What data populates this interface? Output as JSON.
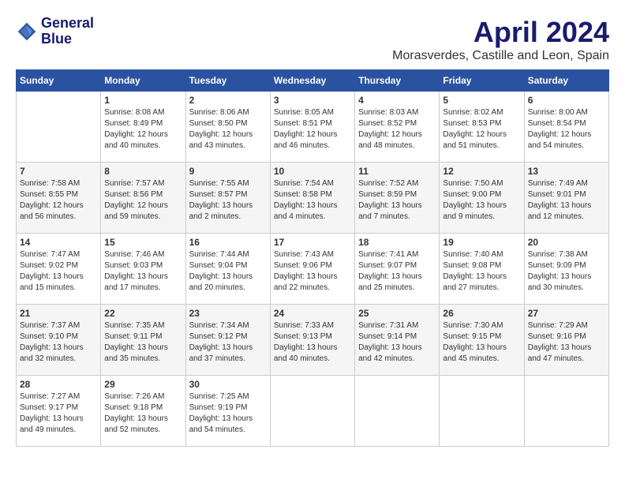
{
  "logo": {
    "line1": "General",
    "line2": "Blue"
  },
  "title": "April 2024",
  "subtitle": "Morasverdes, Castille and Leon, Spain",
  "weekdays": [
    "Sunday",
    "Monday",
    "Tuesday",
    "Wednesday",
    "Thursday",
    "Friday",
    "Saturday"
  ],
  "weeks": [
    [
      {
        "day": "",
        "sunrise": "",
        "sunset": "",
        "daylight": ""
      },
      {
        "day": "1",
        "sunrise": "Sunrise: 8:08 AM",
        "sunset": "Sunset: 8:49 PM",
        "daylight": "Daylight: 12 hours and 40 minutes."
      },
      {
        "day": "2",
        "sunrise": "Sunrise: 8:06 AM",
        "sunset": "Sunset: 8:50 PM",
        "daylight": "Daylight: 12 hours and 43 minutes."
      },
      {
        "day": "3",
        "sunrise": "Sunrise: 8:05 AM",
        "sunset": "Sunset: 8:51 PM",
        "daylight": "Daylight: 12 hours and 46 minutes."
      },
      {
        "day": "4",
        "sunrise": "Sunrise: 8:03 AM",
        "sunset": "Sunset: 8:52 PM",
        "daylight": "Daylight: 12 hours and 48 minutes."
      },
      {
        "day": "5",
        "sunrise": "Sunrise: 8:02 AM",
        "sunset": "Sunset: 8:53 PM",
        "daylight": "Daylight: 12 hours and 51 minutes."
      },
      {
        "day": "6",
        "sunrise": "Sunrise: 8:00 AM",
        "sunset": "Sunset: 8:54 PM",
        "daylight": "Daylight: 12 hours and 54 minutes."
      }
    ],
    [
      {
        "day": "7",
        "sunrise": "Sunrise: 7:58 AM",
        "sunset": "Sunset: 8:55 PM",
        "daylight": "Daylight: 12 hours and 56 minutes."
      },
      {
        "day": "8",
        "sunrise": "Sunrise: 7:57 AM",
        "sunset": "Sunset: 8:56 PM",
        "daylight": "Daylight: 12 hours and 59 minutes."
      },
      {
        "day": "9",
        "sunrise": "Sunrise: 7:55 AM",
        "sunset": "Sunset: 8:57 PM",
        "daylight": "Daylight: 13 hours and 2 minutes."
      },
      {
        "day": "10",
        "sunrise": "Sunrise: 7:54 AM",
        "sunset": "Sunset: 8:58 PM",
        "daylight": "Daylight: 13 hours and 4 minutes."
      },
      {
        "day": "11",
        "sunrise": "Sunrise: 7:52 AM",
        "sunset": "Sunset: 8:59 PM",
        "daylight": "Daylight: 13 hours and 7 minutes."
      },
      {
        "day": "12",
        "sunrise": "Sunrise: 7:50 AM",
        "sunset": "Sunset: 9:00 PM",
        "daylight": "Daylight: 13 hours and 9 minutes."
      },
      {
        "day": "13",
        "sunrise": "Sunrise: 7:49 AM",
        "sunset": "Sunset: 9:01 PM",
        "daylight": "Daylight: 13 hours and 12 minutes."
      }
    ],
    [
      {
        "day": "14",
        "sunrise": "Sunrise: 7:47 AM",
        "sunset": "Sunset: 9:02 PM",
        "daylight": "Daylight: 13 hours and 15 minutes."
      },
      {
        "day": "15",
        "sunrise": "Sunrise: 7:46 AM",
        "sunset": "Sunset: 9:03 PM",
        "daylight": "Daylight: 13 hours and 17 minutes."
      },
      {
        "day": "16",
        "sunrise": "Sunrise: 7:44 AM",
        "sunset": "Sunset: 9:04 PM",
        "daylight": "Daylight: 13 hours and 20 minutes."
      },
      {
        "day": "17",
        "sunrise": "Sunrise: 7:43 AM",
        "sunset": "Sunset: 9:06 PM",
        "daylight": "Daylight: 13 hours and 22 minutes."
      },
      {
        "day": "18",
        "sunrise": "Sunrise: 7:41 AM",
        "sunset": "Sunset: 9:07 PM",
        "daylight": "Daylight: 13 hours and 25 minutes."
      },
      {
        "day": "19",
        "sunrise": "Sunrise: 7:40 AM",
        "sunset": "Sunset: 9:08 PM",
        "daylight": "Daylight: 13 hours and 27 minutes."
      },
      {
        "day": "20",
        "sunrise": "Sunrise: 7:38 AM",
        "sunset": "Sunset: 9:09 PM",
        "daylight": "Daylight: 13 hours and 30 minutes."
      }
    ],
    [
      {
        "day": "21",
        "sunrise": "Sunrise: 7:37 AM",
        "sunset": "Sunset: 9:10 PM",
        "daylight": "Daylight: 13 hours and 32 minutes."
      },
      {
        "day": "22",
        "sunrise": "Sunrise: 7:35 AM",
        "sunset": "Sunset: 9:11 PM",
        "daylight": "Daylight: 13 hours and 35 minutes."
      },
      {
        "day": "23",
        "sunrise": "Sunrise: 7:34 AM",
        "sunset": "Sunset: 9:12 PM",
        "daylight": "Daylight: 13 hours and 37 minutes."
      },
      {
        "day": "24",
        "sunrise": "Sunrise: 7:33 AM",
        "sunset": "Sunset: 9:13 PM",
        "daylight": "Daylight: 13 hours and 40 minutes."
      },
      {
        "day": "25",
        "sunrise": "Sunrise: 7:31 AM",
        "sunset": "Sunset: 9:14 PM",
        "daylight": "Daylight: 13 hours and 42 minutes."
      },
      {
        "day": "26",
        "sunrise": "Sunrise: 7:30 AM",
        "sunset": "Sunset: 9:15 PM",
        "daylight": "Daylight: 13 hours and 45 minutes."
      },
      {
        "day": "27",
        "sunrise": "Sunrise: 7:29 AM",
        "sunset": "Sunset: 9:16 PM",
        "daylight": "Daylight: 13 hours and 47 minutes."
      }
    ],
    [
      {
        "day": "28",
        "sunrise": "Sunrise: 7:27 AM",
        "sunset": "Sunset: 9:17 PM",
        "daylight": "Daylight: 13 hours and 49 minutes."
      },
      {
        "day": "29",
        "sunrise": "Sunrise: 7:26 AM",
        "sunset": "Sunset: 9:18 PM",
        "daylight": "Daylight: 13 hours and 52 minutes."
      },
      {
        "day": "30",
        "sunrise": "Sunrise: 7:25 AM",
        "sunset": "Sunset: 9:19 PM",
        "daylight": "Daylight: 13 hours and 54 minutes."
      },
      {
        "day": "",
        "sunrise": "",
        "sunset": "",
        "daylight": ""
      },
      {
        "day": "",
        "sunrise": "",
        "sunset": "",
        "daylight": ""
      },
      {
        "day": "",
        "sunrise": "",
        "sunset": "",
        "daylight": ""
      },
      {
        "day": "",
        "sunrise": "",
        "sunset": "",
        "daylight": ""
      }
    ]
  ]
}
